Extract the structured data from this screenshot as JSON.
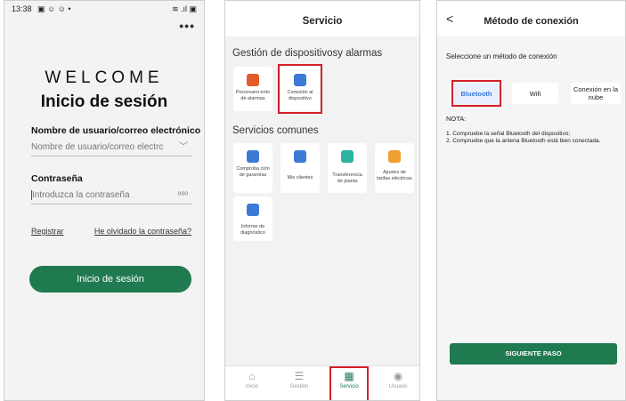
{
  "login": {
    "status_time": "13:38",
    "status_icons": "▣ ☺ ☺ •",
    "status_right": "≋ .ıl ▣",
    "menu": "•••",
    "welcome": "WELCOME",
    "title": "Inicio de sesión",
    "username_label": "Nombre de usuario/correo electrónico",
    "username_placeholder": "Nombre de usuario/correo electrc",
    "password_label": "Contraseña",
    "password_placeholder": "Introduzca la contraseña",
    "password_toggle": "ᵒᵒᵒ",
    "register": "Registrar",
    "forgot": "He olvidado la contraseña?",
    "login_button": "Inicio de sesión"
  },
  "servicio": {
    "title": "Servicio",
    "section1": "Gestión de dispositivosy alarmas",
    "tiles1": [
      {
        "label": "Procesami ento de alarmas",
        "color": "#e35b2a"
      },
      {
        "label": "Conexión al dispositivo",
        "color": "#3b7bd6"
      }
    ],
    "section2": "Servicios comunes",
    "tiles2": [
      {
        "label": "Comproba ción de garantías",
        "color": "#3b7bd6"
      },
      {
        "label": "Mis clientes",
        "color": "#3b7bd6"
      },
      {
        "label": "Transferencia de planta",
        "color": "#2bb3a0"
      },
      {
        "label": "Ajustes de tarifas eléctricas",
        "color": "#f0a030"
      },
      {
        "label": "Informe de diagnóstico",
        "color": "#3b7bd6"
      }
    ],
    "tabs": [
      {
        "label": "Inicio",
        "icon": "⌂"
      },
      {
        "label": "Gestión",
        "icon": "☰"
      },
      {
        "label": "Servicio",
        "icon": "▦"
      },
      {
        "label": "Usuario",
        "icon": "◉"
      }
    ],
    "active_tab_color": "#1f7a50",
    "highlight_color": "#d4202a"
  },
  "conexion": {
    "back": "<",
    "title": "Método de conexión",
    "prompt": "Seleccione un método de conexión",
    "options": [
      "Bluetooth",
      "Wifi",
      "Conexión en la nube"
    ],
    "note_label": "NOTA:",
    "note_line1": "1. Compruebe la señal Bluetooth del dispositivo;",
    "note_line2": "2. Compruebe que la antena Bluetooth está bien conectada.",
    "next_button": "SIGUIENTE PASO"
  }
}
